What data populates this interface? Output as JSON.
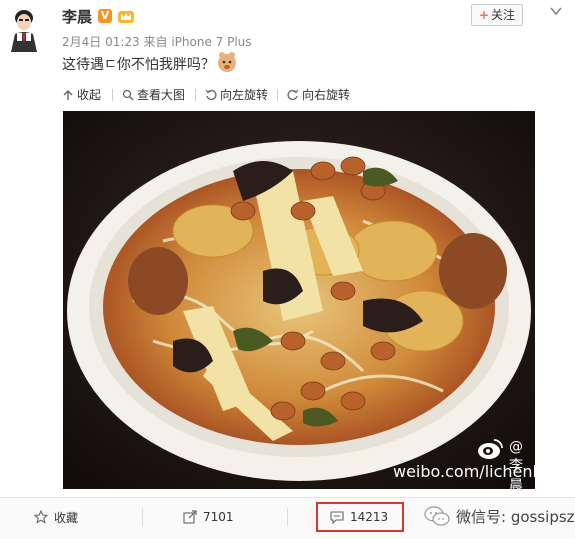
{
  "post": {
    "author": "李晨",
    "verified_badge": "V",
    "time": "2月4日 01:23",
    "source_prefix": "来自",
    "source": "iPhone 7 Plus",
    "text": "这待遇ㄷ你不怕我胖吗？",
    "follow_label": "关注",
    "follow_plus": "+"
  },
  "image_toolbar": {
    "collect": "收起",
    "view_large": "查看大图",
    "rotate_left": "向左旋转",
    "rotate_right": "向右旋转"
  },
  "image": {
    "watermark_name": "@李晨",
    "watermark_url": "weibo.com/lichenlichen"
  },
  "actions": {
    "favorite": "收藏",
    "repost_count": "7101",
    "comment_count": "14213"
  },
  "wechat_watermark": "微信号: gossipsz",
  "colors": {
    "accent_orange": "#eb7350",
    "highlight_red": "#d9382f",
    "badge_orange": "#f7931e"
  },
  "icons": [
    "avatar",
    "verified-icon",
    "crown-icon",
    "chevron-down-icon",
    "emoji-icon",
    "collect-icon",
    "zoom-icon",
    "rotate-left-icon",
    "rotate-right-icon",
    "star-icon",
    "repost-icon",
    "comment-icon",
    "wechat-icon",
    "weibo-icon"
  ]
}
